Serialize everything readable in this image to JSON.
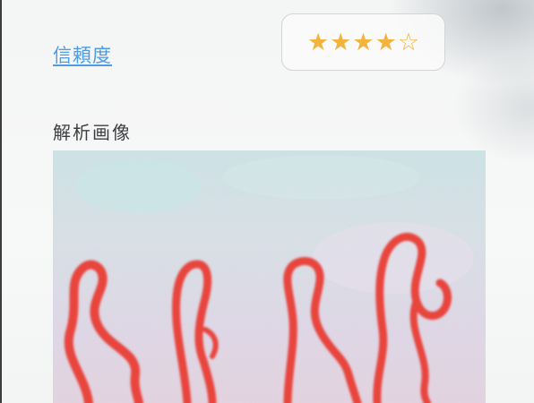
{
  "trust": {
    "link_label": "信頼度"
  },
  "rating": {
    "value": 4,
    "max": 5,
    "filled_color": "#f2b43c",
    "empty_color": "#f2b43c",
    "filled_glyph": "★",
    "empty_glyph": "☆"
  },
  "analysis": {
    "label": "解析画像"
  }
}
